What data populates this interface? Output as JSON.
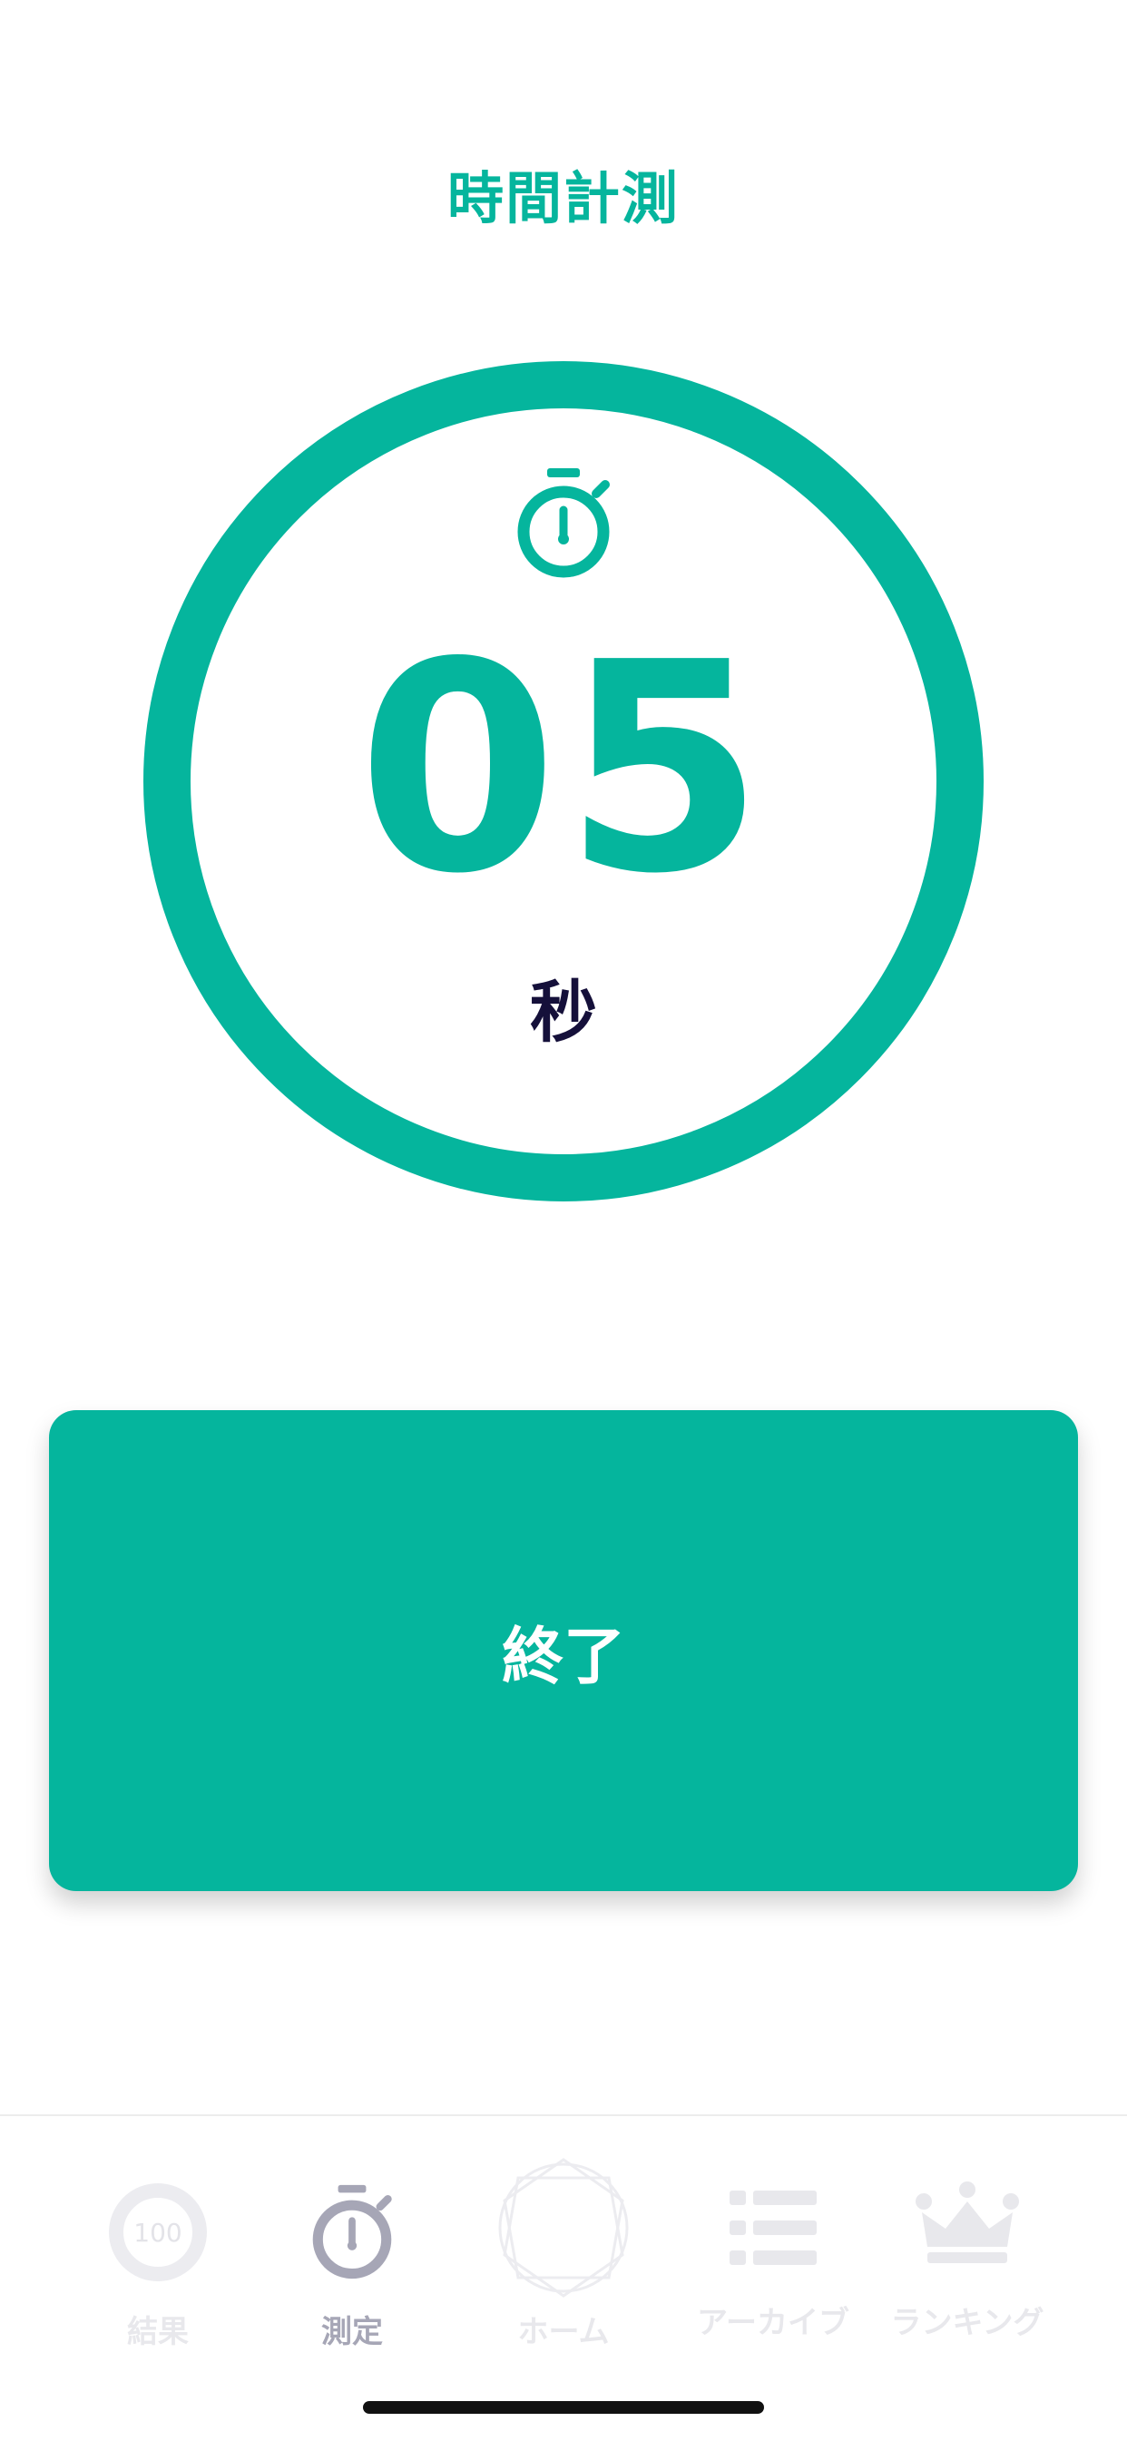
{
  "header": {
    "title": "時間計測"
  },
  "timer": {
    "value": "05",
    "unit": "秒",
    "icon": "stopwatch-icon"
  },
  "actions": {
    "end_label": "終了"
  },
  "tabbar": {
    "items": [
      {
        "label": "結果",
        "icon": "score-ring-icon",
        "icon_text": "100",
        "active": false
      },
      {
        "label": "測定",
        "icon": "stopwatch-icon",
        "active": true
      },
      {
        "label": "ホーム",
        "icon": "home-emblem-icon",
        "active": false
      },
      {
        "label": "アーカイブ",
        "icon": "list-icon",
        "active": false
      },
      {
        "label": "ランキング",
        "icon": "crown-icon",
        "active": false
      }
    ]
  },
  "colors": {
    "accent": "#05b59d",
    "unit_text": "#15103a",
    "tab_active": "#a6a6b6",
    "tab_inactive": "#e8e8ec"
  }
}
